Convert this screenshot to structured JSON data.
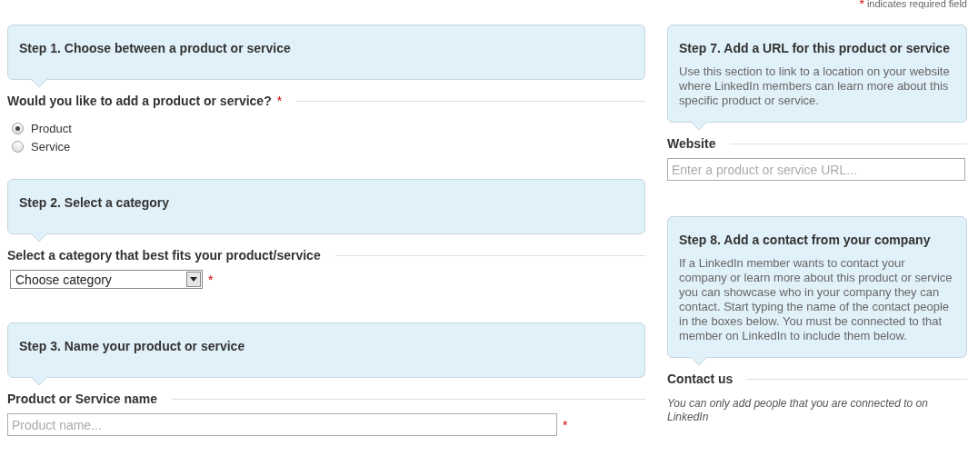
{
  "required_note": {
    "mark": "*",
    "text": "indicates required field"
  },
  "left": [
    {
      "step": {
        "title": "Step 1. Choose between a product or service"
      },
      "field": {
        "label": "Would you like to add a product or service?",
        "required_mark": "*",
        "kind": "radio",
        "options": [
          {
            "label": "Product",
            "selected": true
          },
          {
            "label": "Service",
            "selected": false
          }
        ]
      }
    },
    {
      "step": {
        "title": "Step 2. Select a category"
      },
      "field": {
        "label": "Select a category that best fits your product/service",
        "kind": "select",
        "value": "Choose category",
        "required_mark": "*"
      }
    },
    {
      "step": {
        "title": "Step 3. Name your product or service"
      },
      "field": {
        "label": "Product or Service name",
        "kind": "text",
        "placeholder": "Product name...",
        "required_mark": "*"
      }
    }
  ],
  "right": [
    {
      "step": {
        "title": "Step 7. Add a URL for this product or service",
        "description": "Use this section to link to a location on your website where LinkedIn members can learn more about this specific product or service."
      },
      "field": {
        "label": "Website",
        "kind": "text",
        "placeholder": "Enter a product or service URL..."
      }
    },
    {
      "step": {
        "title": "Step 8. Add a contact from your company",
        "description": "If a LinkedIn member wants to contact your company or learn more about this product or service you can showcase who in your company they can contact. Start typing the name of the contact people in the boxes below. You must be connected to that member on LinkedIn to include them below."
      },
      "field": {
        "label": "Contact us",
        "kind": "note",
        "note": "You can only add people that you are connected to on LinkedIn"
      }
    }
  ]
}
